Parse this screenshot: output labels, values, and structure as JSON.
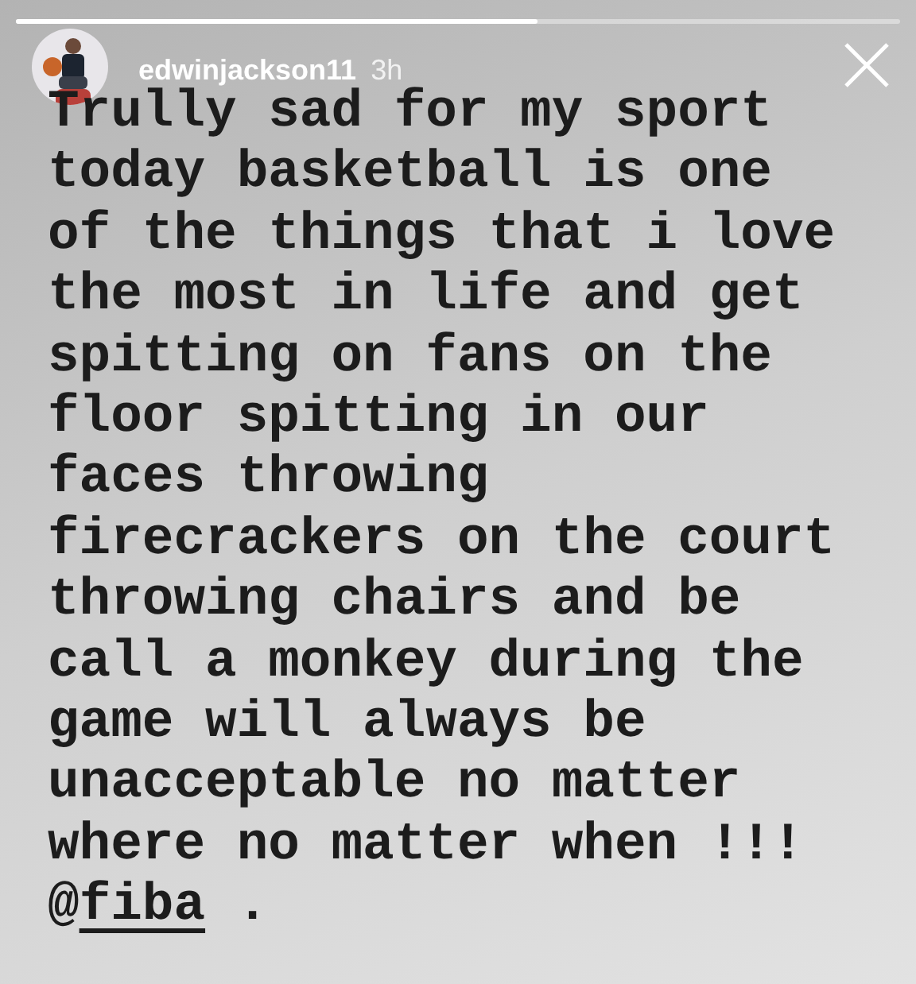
{
  "progress": {
    "level": 0.59
  },
  "header": {
    "username": "edwinjackson11",
    "time": "3h"
  },
  "lines": [
    "Trully sad for my sport",
    "today basketball is one",
    "of the things that i love",
    "the most in life and get",
    "spitting on fans on the",
    "floor spitting in our",
    "faces throwing",
    "firecrackers on the court",
    "throwing chairs and be",
    "call a monkey during the",
    "game will always be",
    "unacceptable no matter",
    "where no matter when !!!"
  ],
  "mention_line": {
    "prefix": "@",
    "mention": "fiba",
    "suffix": " ."
  }
}
